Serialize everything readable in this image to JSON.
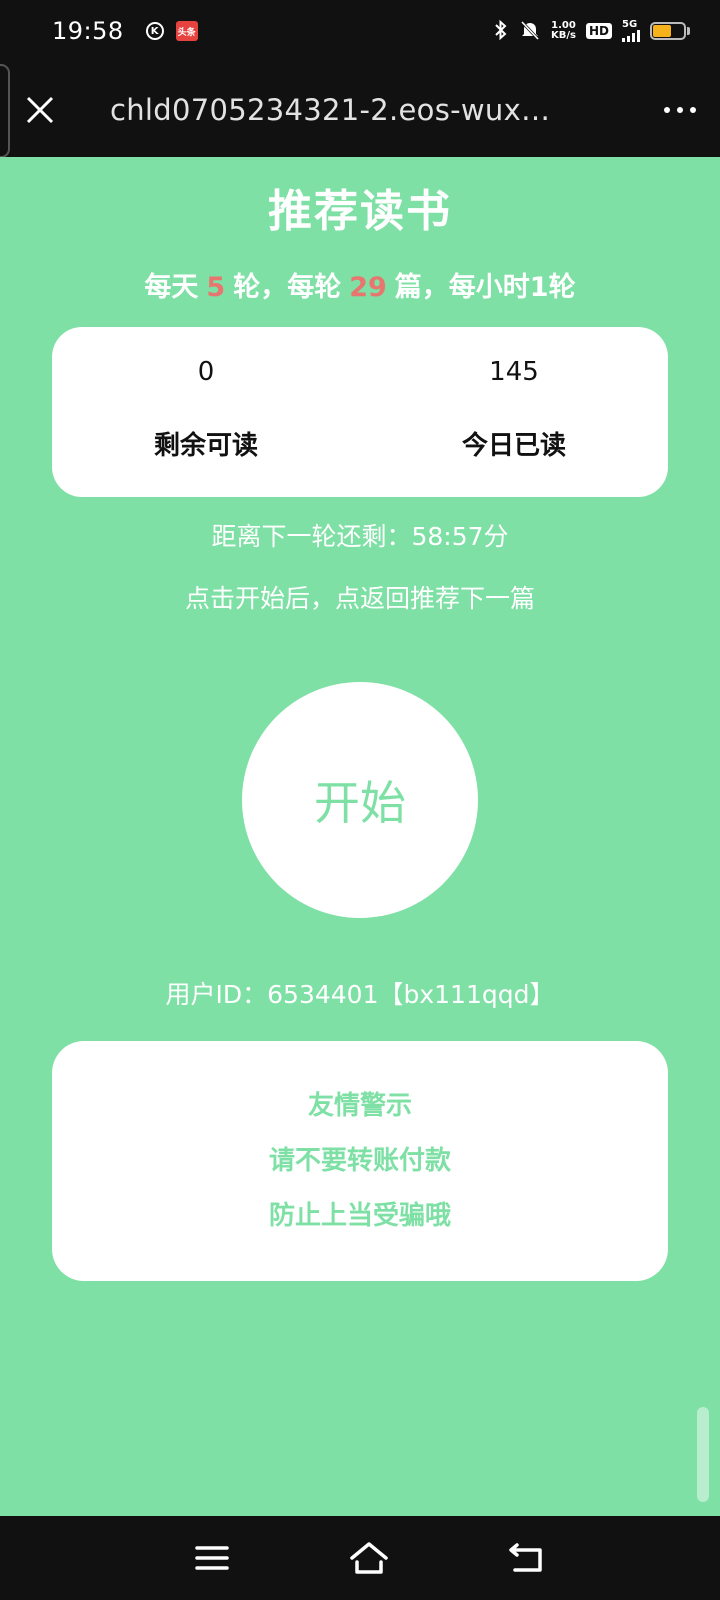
{
  "status_bar": {
    "time": "19:58",
    "app_icon_k": "K",
    "app_icon_toutiao": "头条",
    "net_speed_value": "1.00",
    "net_speed_unit": "KB/s",
    "hd_label": "HD",
    "network_label": "5G",
    "battery_level": 0.6,
    "battery_color": "#f5b21a"
  },
  "browser": {
    "url": "chld0705234321-2.eos-wux…"
  },
  "page": {
    "title": "推荐读书",
    "rule": {
      "part1": "每天",
      "rounds_per_day": "5",
      "part2": "轮，每轮",
      "articles_per_round": "29",
      "part3": "篇，每小时1轮"
    },
    "stats": {
      "remaining_value": "0",
      "remaining_label": "剩余可读",
      "read_today_value": "145",
      "read_today_label": "今日已读"
    },
    "countdown": "距离下一轮还剩：58:57分",
    "hint": "点击开始后，点返回推荐下一篇",
    "start_label": "开始",
    "user_id": "用户ID：6534401【bx111qqd】",
    "warning": {
      "line1": "友情警示",
      "line2": "请不要转账付款",
      "line3": "防止上当受骗哦"
    }
  },
  "colors": {
    "background_green": "#7ee0a5",
    "highlight_red": "#e8766e",
    "card_white": "#ffffff",
    "chrome_dark": "#111111"
  },
  "nav_bar": {
    "icons": [
      "menu-icon",
      "home-icon",
      "back-icon"
    ]
  }
}
